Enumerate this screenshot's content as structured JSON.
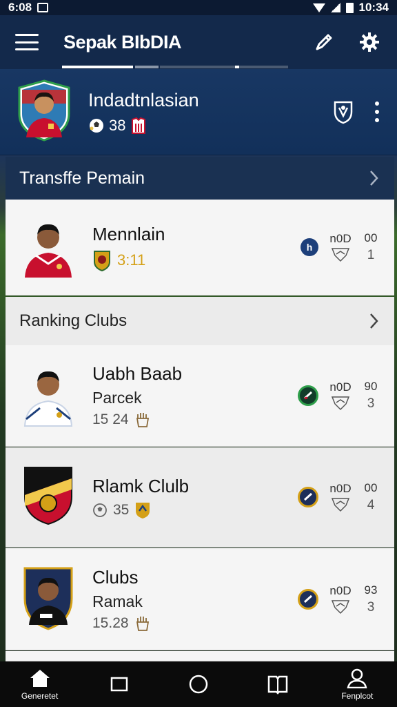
{
  "status_bar": {
    "time_left": "6:08",
    "time_right": "10:34"
  },
  "app_bar": {
    "title": "Sepak BIbDIA"
  },
  "profile": {
    "name": "Indadtnlasian",
    "stat": "38"
  },
  "transfer_section": {
    "title": "Transffe Pemain"
  },
  "transfer_player": {
    "name": "Mennlain",
    "rating": "3:11",
    "stat_label": "n0D",
    "stat_top": "00",
    "stat_bottom": "1"
  },
  "ranking_section": {
    "title": "Ranking Clubs"
  },
  "ranking_items": [
    {
      "title": "Uabh Baab",
      "subtitle": "Parcek",
      "meta": "15 24",
      "stat_label": "n0D",
      "stat_top": "90",
      "stat_bottom": "3"
    },
    {
      "title": "Rlamk Clulb",
      "subtitle": "",
      "meta": "35",
      "stat_label": "n0D",
      "stat_top": "00",
      "stat_bottom": "4"
    },
    {
      "title": "Clubs",
      "subtitle": "Ramak",
      "meta": "15.28",
      "stat_label": "n0D",
      "stat_top": "93",
      "stat_bottom": "3"
    }
  ],
  "bottom_nav": {
    "home_label": "Generetet",
    "profile_label": "Fenplcot"
  },
  "colors": {
    "navy": "#13294b",
    "accent_green": "#2e9e4a",
    "gold": "#d4a017",
    "jersey_red": "#c8102e"
  }
}
